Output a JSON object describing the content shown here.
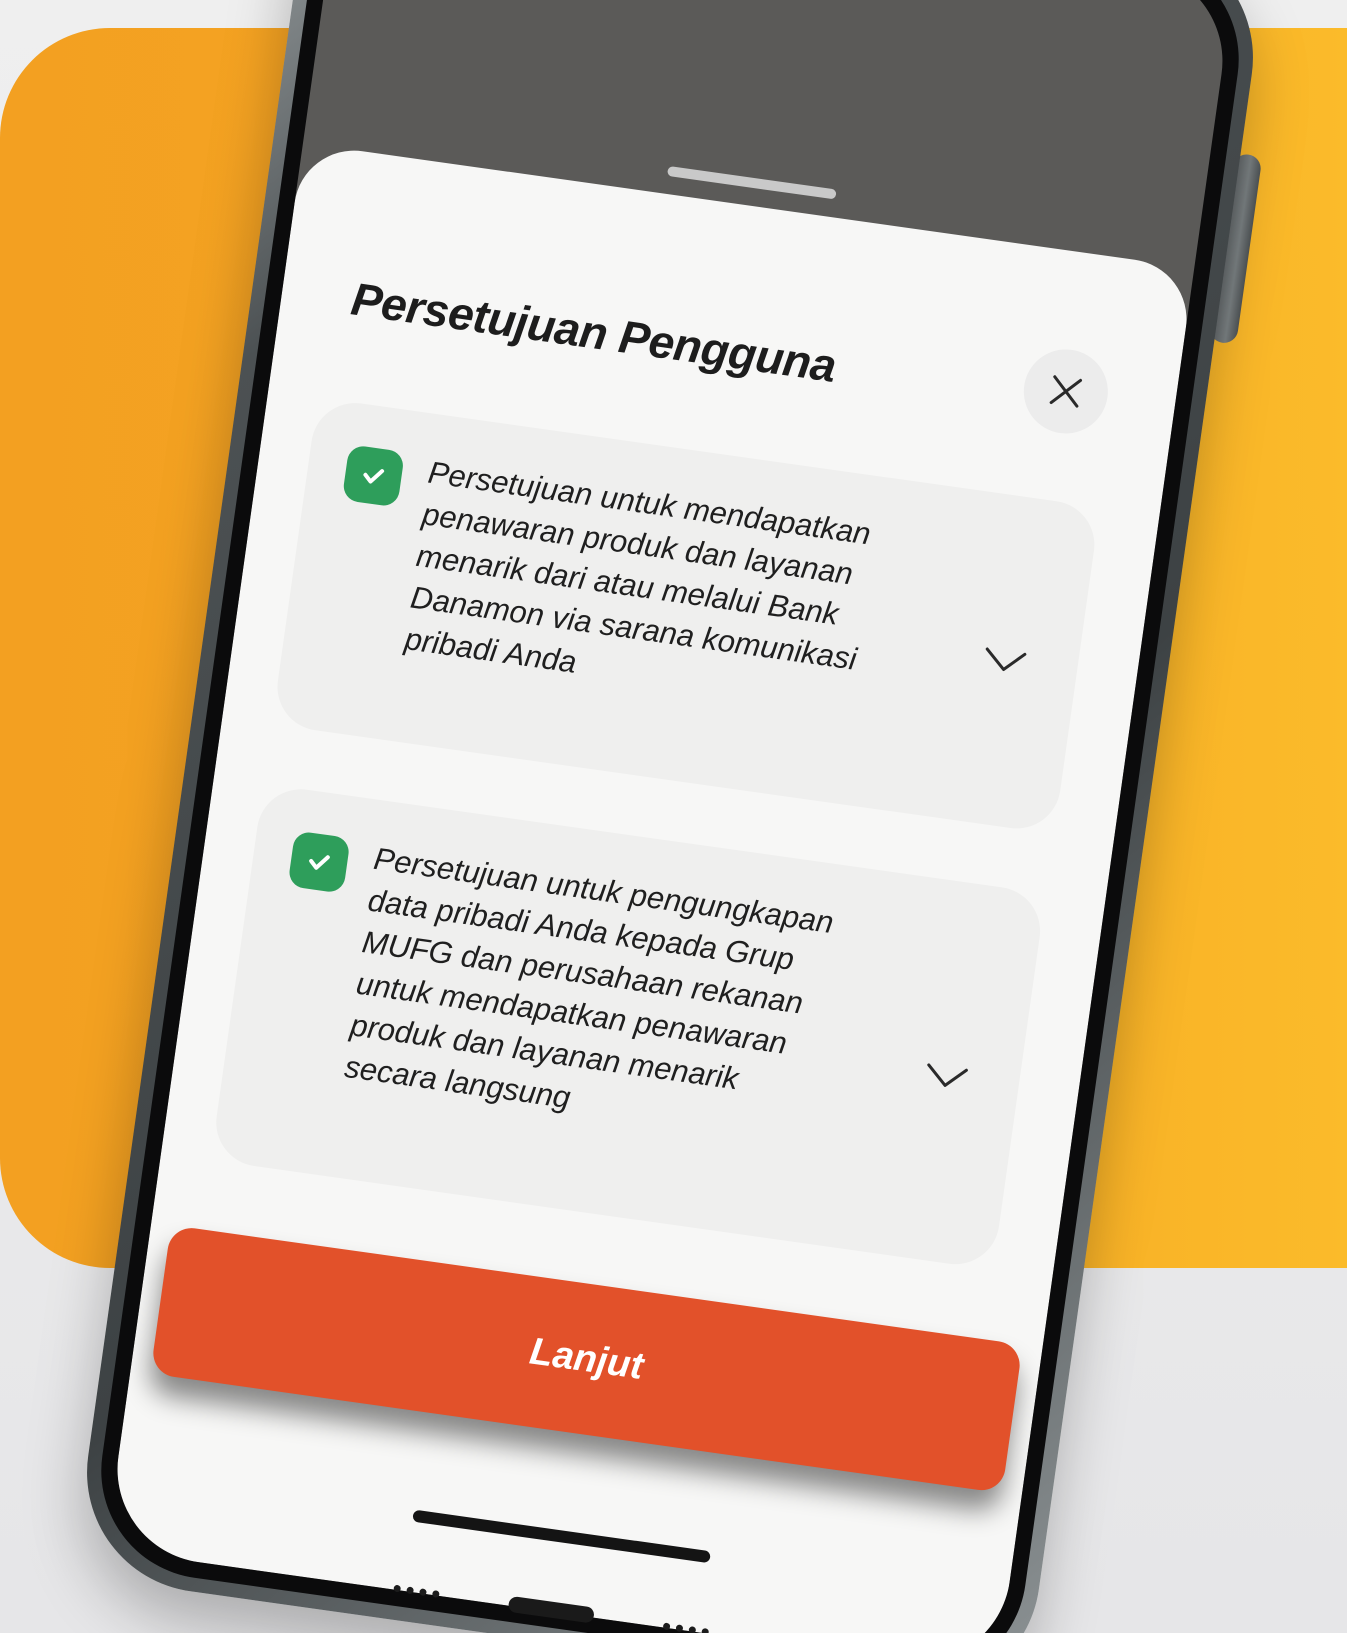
{
  "sheet": {
    "title": "Persetujuan Pengguna",
    "close_icon": "close-icon"
  },
  "consents": [
    {
      "checked": true,
      "text": "Persetujuan untuk mendapatkan penawaran produk dan layanan menarik dari atau melalui Bank Danamon via sarana komunikasi pribadi Anda"
    },
    {
      "checked": true,
      "text": "Persetujuan untuk pengungkapan data pribadi Anda kepada Grup MUFG dan perusahaan rekanan untuk mendapatkan penawaran produk dan layanan menarik secara langsung"
    }
  ],
  "cta": {
    "label": "Lanjut"
  },
  "colors": {
    "background_accent": "#f5a623",
    "check_green": "#2e9e5b",
    "cta_orange": "#e2512a"
  }
}
